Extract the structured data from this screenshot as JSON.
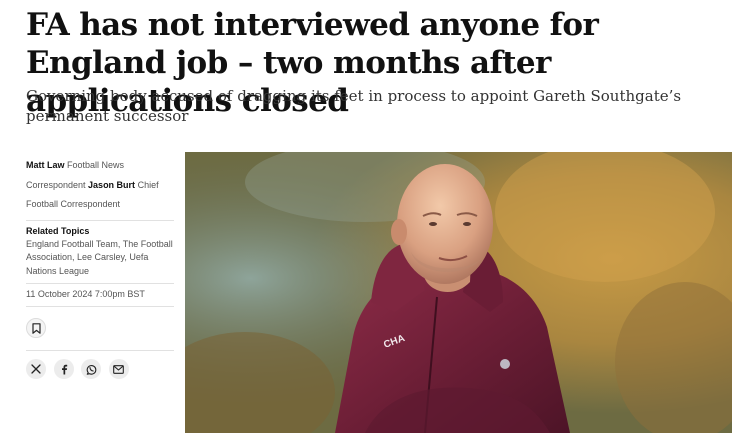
{
  "article": {
    "headline": "FA has not interviewed anyone for England job – two months after applications closed",
    "standfirst": "Governing body accused of dragging its feet in process to appoint Gareth Southgate’s permanent successor"
  },
  "byline": {
    "author1": "Matt Law",
    "author1_role": " Football News Correspondent ",
    "author2": "Jason Burt",
    "author2_role": " Chief Football Correspondent"
  },
  "related": {
    "heading": "Related Topics",
    "topics": "England Football Team, The Football Association, Lee Carsley, Uefa Nations League"
  },
  "published": "11 October 2024 7:00pm BST",
  "icons": {
    "save": "bookmark-icon",
    "share": [
      "x-twitter-icon",
      "facebook-icon",
      "whatsapp-icon",
      "email-icon"
    ]
  },
  "hero_image": {
    "jacket_text": "CHA"
  },
  "colors": {
    "text": "#111111",
    "muted": "#555555",
    "icon_bg": "#ececec"
  }
}
